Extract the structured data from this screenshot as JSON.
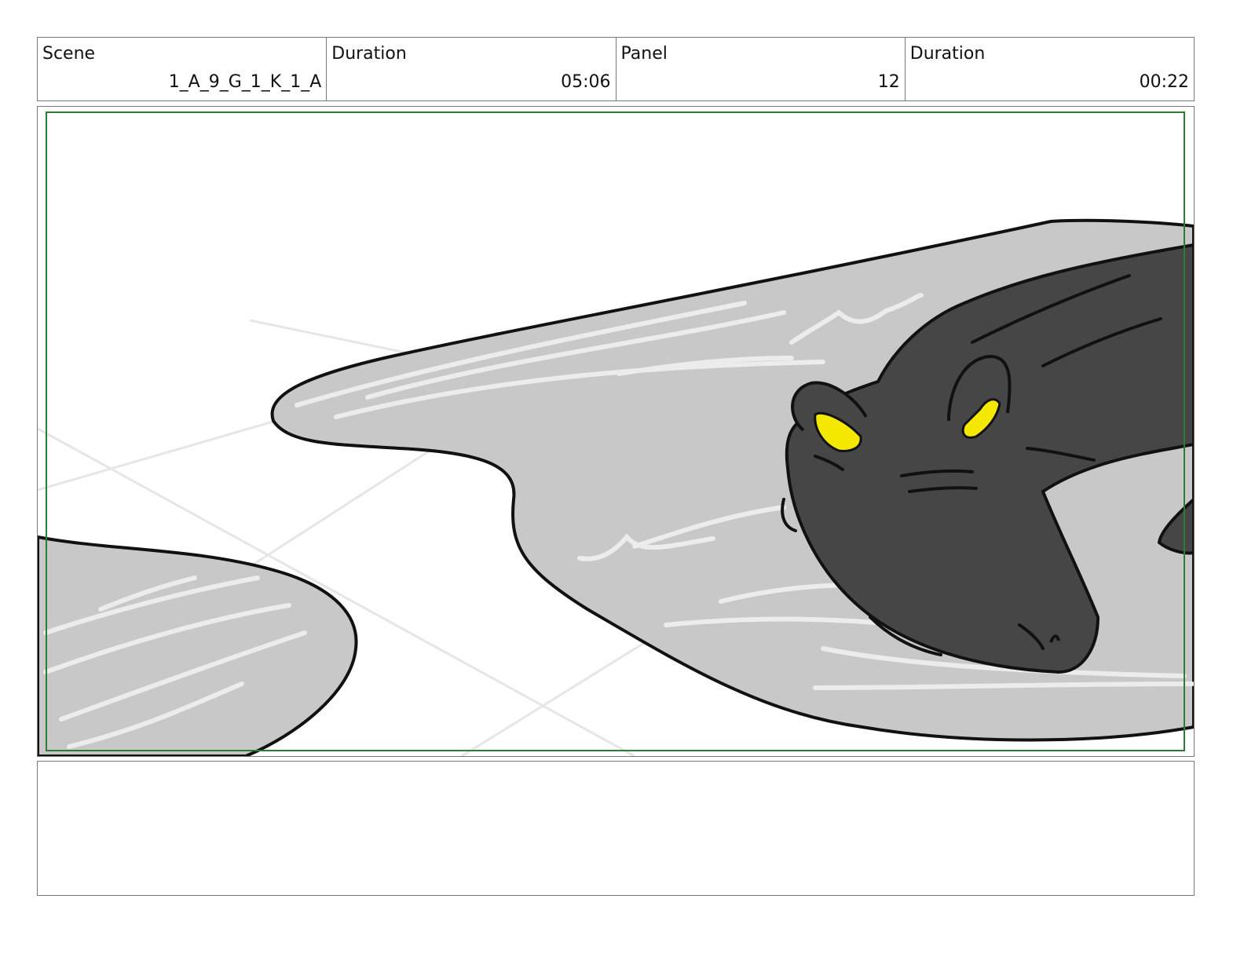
{
  "header": {
    "scene_label": "Scene",
    "scene_value": "1_A_9_G_1_K_1_A",
    "scene_duration_label": "Duration",
    "scene_duration_value": "05:06",
    "panel_label": "Panel",
    "panel_value": "12",
    "panel_duration_label": "Duration",
    "panel_duration_value": "00:22"
  },
  "colors": {
    "frame": "#2e7d32",
    "water": "#c8c8c8",
    "creature": "#464646",
    "eyes": "#f5e800"
  },
  "illustration": {
    "subject": "dark crocodile-like creature with yellow eyes lying in shallow water"
  },
  "notes": {
    "text": ""
  }
}
